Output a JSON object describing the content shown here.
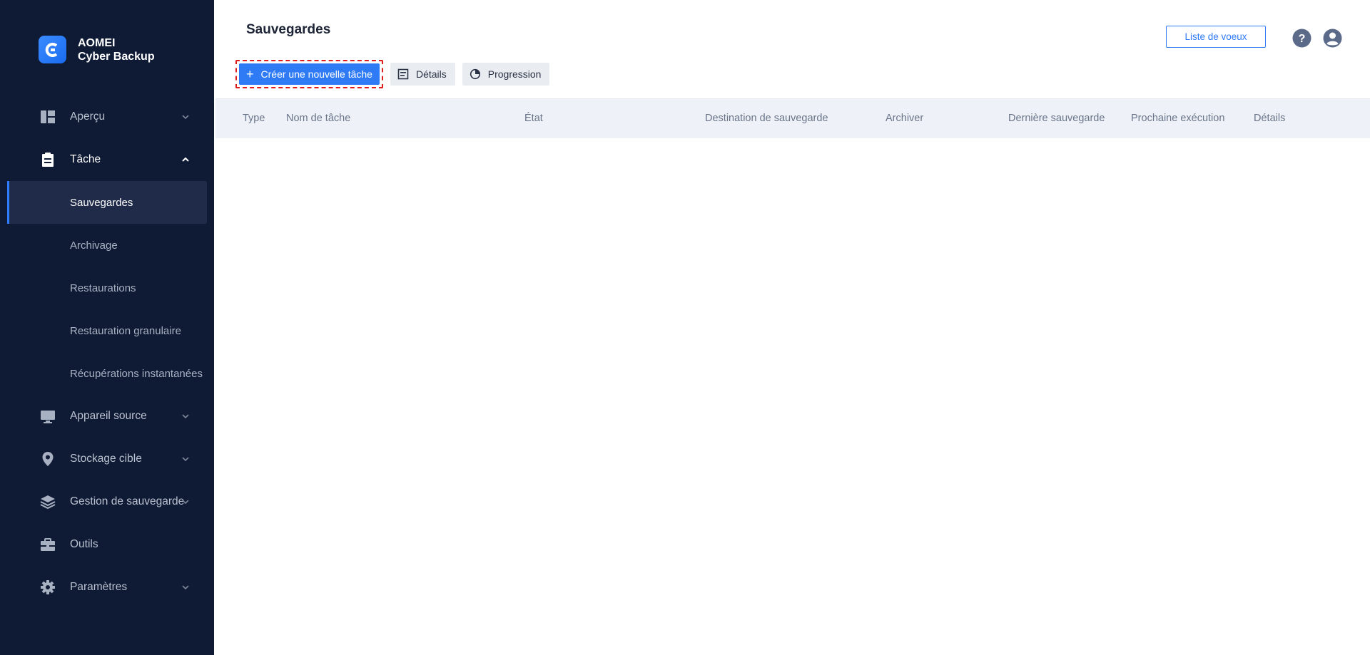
{
  "brand": {
    "line1": "AOMEI",
    "line2": "Cyber Backup"
  },
  "sidebar": {
    "items": [
      {
        "label": "Aperçu",
        "icon": "dashboard-icon"
      },
      {
        "label": "Tâche",
        "icon": "clipboard-icon"
      },
      {
        "label": "Appareil source",
        "icon": "monitor-icon"
      },
      {
        "label": "Stockage cible",
        "icon": "location-pin-icon"
      },
      {
        "label": "Gestion de sauvegarde",
        "icon": "layers-icon"
      },
      {
        "label": "Outils",
        "icon": "toolbox-icon"
      },
      {
        "label": "Paramètres",
        "icon": "gear-icon"
      }
    ],
    "task_subitems": [
      {
        "label": "Sauvegardes",
        "active": true
      },
      {
        "label": "Archivage"
      },
      {
        "label": "Restaurations"
      },
      {
        "label": "Restauration granulaire"
      },
      {
        "label": "Récupérations instantanées"
      }
    ]
  },
  "header": {
    "title": "Sauvegardes",
    "wishlist_label": "Liste de voeux",
    "help_icon": "help-icon",
    "user_icon": "user-avatar-icon"
  },
  "toolbar": {
    "create_label": "Créer une nouvelle tâche",
    "details_label": "Détails",
    "progress_label": "Progression"
  },
  "table": {
    "columns": [
      "Type",
      "Nom de tâche",
      "État",
      "Destination de sauvegarde",
      "Archiver",
      "Dernière sauvegarde",
      "Prochaine exécution",
      "Détails"
    ],
    "rows": []
  },
  "colors": {
    "sidebar_bg": "#0f1a35",
    "accent": "#2f7bf5",
    "highlight": "#e01b1b"
  }
}
